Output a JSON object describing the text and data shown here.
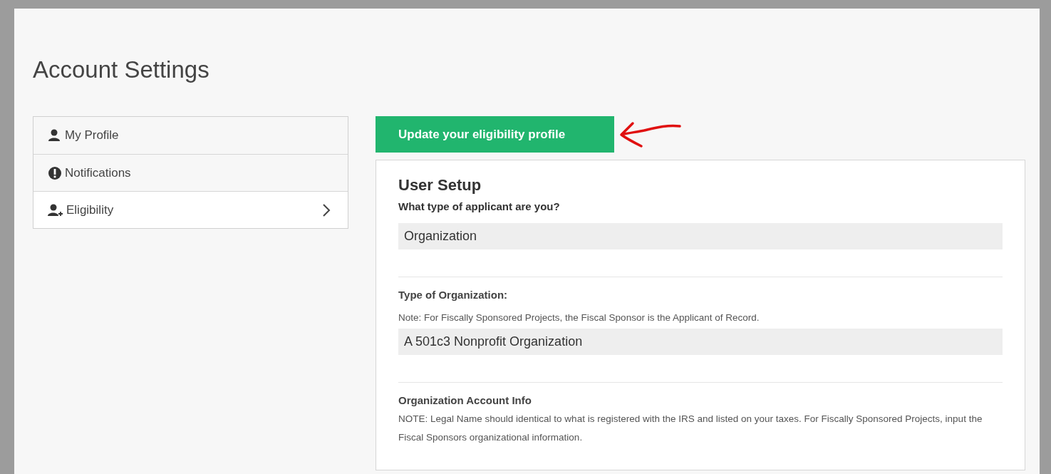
{
  "page_title": "Account Settings",
  "sidebar": {
    "items": [
      {
        "label": "My Profile",
        "selected": false
      },
      {
        "label": "Notifications",
        "selected": false
      },
      {
        "label": "Eligibility",
        "selected": true
      }
    ]
  },
  "update_button": "Update your eligibility profile",
  "card": {
    "title": "User Setup",
    "fields": [
      {
        "label": "What type of applicant are you?",
        "value": "Organization"
      },
      {
        "label": "Type of Organization:",
        "note": "Note: For Fiscally Sponsored Projects, the Fiscal Sponsor is the Applicant of Record.",
        "value": "A 501c3 Nonprofit Organization"
      },
      {
        "label": "Organization Account Info",
        "note": "NOTE: Legal Name should identical to what is registered with the IRS and listed on your taxes. For Fiscally Sponsored Projects, input the Fiscal Sponsors organizational information."
      }
    ]
  }
}
